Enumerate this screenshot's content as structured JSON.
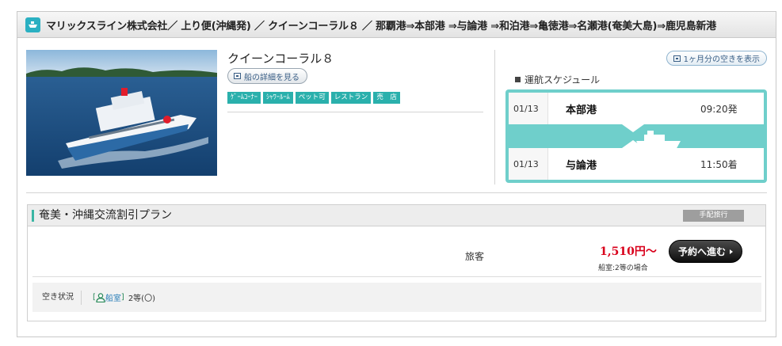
{
  "header": {
    "route": "マリックスライン株式会社／ 上り便(沖縄発) ／ クイーンコーラル８ ／ 那覇港⇒本部港 ⇒与論港 ⇒和泊港⇒亀徳港⇒名瀬港(奄美大島)⇒鹿児島新港",
    "icon": "ship-icon"
  },
  "ship": {
    "name": "クイーンコーラル８",
    "detail_button": "船の詳細を見る",
    "tags": [
      "ｹﾞｰﾑｺｰﾅｰ",
      "ｼｬﾜｰﾙｰﾑ",
      "ペット可",
      "レストラン",
      "売　店"
    ]
  },
  "schedule": {
    "month_button": "1ヶ月分の空きを表示",
    "title": "運航スケジュール",
    "departure": {
      "date": "01/13",
      "port": "本部港",
      "time": "09:20発"
    },
    "arrival": {
      "date": "01/13",
      "port": "与論港",
      "time": "11:50着"
    }
  },
  "plan": {
    "title": "奄美・沖縄交流割引プラン",
    "agency_badge": "手配旅行",
    "fare_label": "旅客",
    "price": "1,510円～",
    "price_note": "船室:2等の場合",
    "book_button": "予約へ進む",
    "vacancy_label": "空き状況",
    "cabin_link_open": "[",
    "cabin_link": "船室",
    "cabin_link_close": "]",
    "cabin_value": "2等(〇)"
  },
  "colors": {
    "accent_teal": "#2ab0ac",
    "schedule_teal": "#6fcfcb",
    "price_red": "#d9001b",
    "button_black": "#0d0d0d"
  }
}
